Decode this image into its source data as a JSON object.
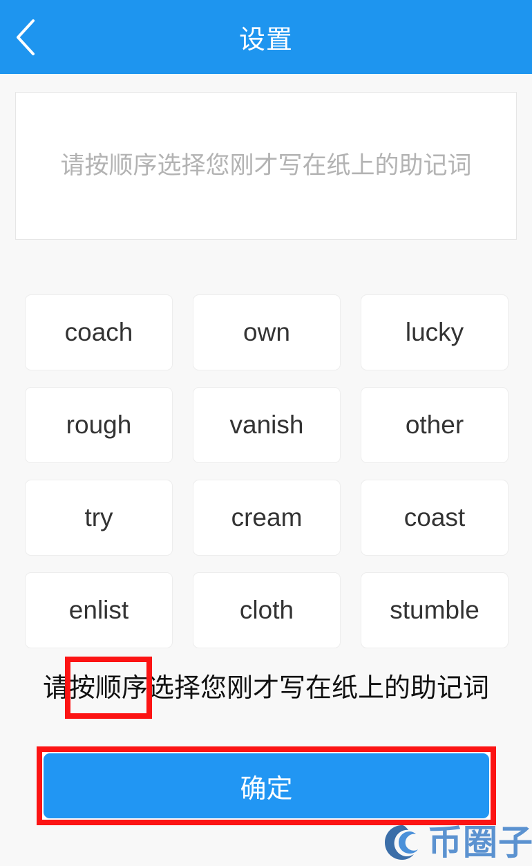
{
  "header": {
    "title": "设置",
    "back_icon": "chevron-left-icon",
    "background_color": "#1e95ef"
  },
  "mnemonic_input": {
    "placeholder": "请按顺序选择您刚才写在纸上的助记词",
    "value": ""
  },
  "word_grid": {
    "words": [
      "coach",
      "own",
      "lucky",
      "rough",
      "vanish",
      "other",
      "try",
      "cream",
      "coast",
      "enlist",
      "cloth",
      "stumble"
    ]
  },
  "caption": {
    "prefix": "请",
    "highlight": "按顺序",
    "suffix": "选择您刚才写在纸上的助记词",
    "highlight_color": "#fc1414"
  },
  "confirm": {
    "label": "确定",
    "button_color": "#2196f3",
    "annotation_color": "#fc1414"
  },
  "watermark": {
    "text": "币圈子",
    "icon": "coin-swirl-logo-icon",
    "color": "#5b92d0"
  }
}
